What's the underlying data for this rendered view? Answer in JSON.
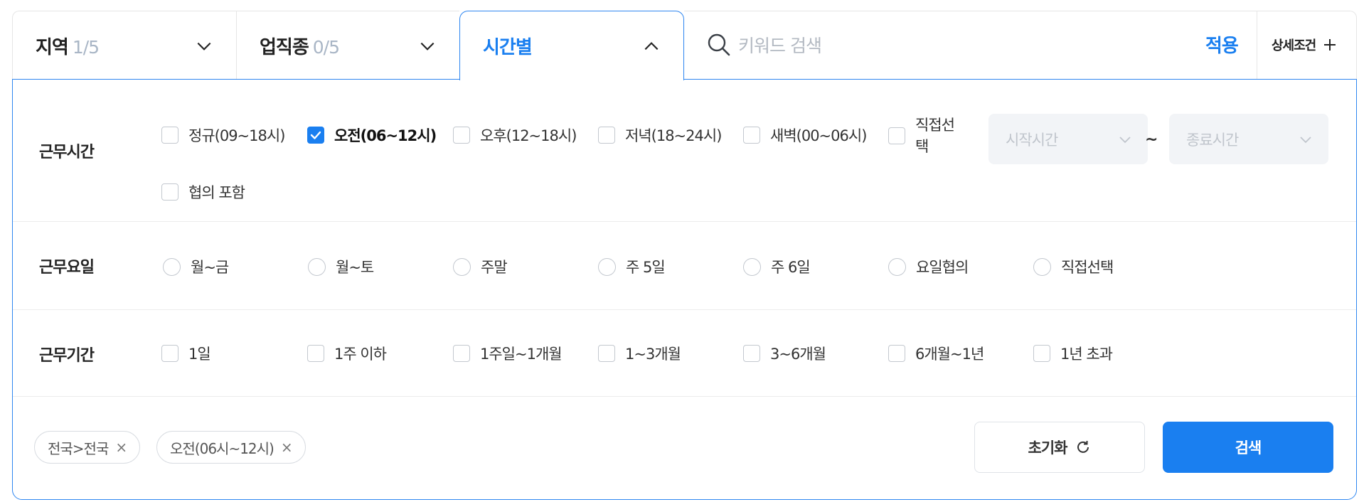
{
  "tabs": {
    "region": {
      "label": "지역",
      "count": "1/5"
    },
    "industry": {
      "label": "업직종",
      "count": "0/5"
    },
    "time": {
      "label": "시간별"
    }
  },
  "search": {
    "placeholder": "키워드 검색",
    "apply_label": "적용",
    "advanced_label": "상세조건"
  },
  "work_hours": {
    "label": "근무시간",
    "options": [
      {
        "label": "정규(09~18시)",
        "checked": false
      },
      {
        "label": "오전(06~12시)",
        "checked": true
      },
      {
        "label": "오후(12~18시)",
        "checked": false
      },
      {
        "label": "저녁(18~24시)",
        "checked": false
      },
      {
        "label": "새벽(00~06시)",
        "checked": false
      },
      {
        "label": "직접선택",
        "checked": false
      },
      {
        "label": "협의 포함",
        "checked": false
      }
    ],
    "start_placeholder": "시작시간",
    "end_placeholder": "종료시간",
    "separator": "~"
  },
  "work_days": {
    "label": "근무요일",
    "options": [
      "월~금",
      "월~토",
      "주말",
      "주 5일",
      "주 6일",
      "요일협의",
      "직접선택"
    ]
  },
  "work_period": {
    "label": "근무기간",
    "options": [
      "1일",
      "1주 이하",
      "1주일~1개월",
      "1~3개월",
      "3~6개월",
      "6개월~1년",
      "1년 초과"
    ]
  },
  "chips": [
    {
      "label": "전국>전국"
    },
    {
      "label": "오전(06시~12시)"
    }
  ],
  "chip_remove": "×",
  "footer": {
    "reset_label": "초기화",
    "search_label": "검색"
  },
  "colors": {
    "accent": "#1a7ff0",
    "muted": "#a9b6c6"
  }
}
